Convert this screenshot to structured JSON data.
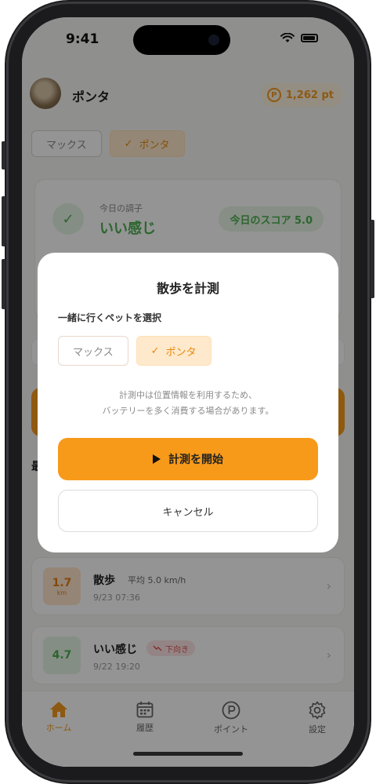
{
  "status_bar": {
    "time": "9:41"
  },
  "header": {
    "pet_name": "ポンタ",
    "points": "1,262 pt",
    "points_icon": "P"
  },
  "pet_chips": [
    {
      "label": "マックス",
      "selected": false
    },
    {
      "label": "ポンタ",
      "selected": true
    }
  ],
  "status_card": {
    "label": "今日の調子",
    "value": "いい感じ",
    "score": "今日のスコア 5.0"
  },
  "section_title": "最",
  "history": [
    {
      "badge_value": "1.7",
      "badge_unit": "km",
      "title": "散歩",
      "subtitle": "平均 5.0 km/h",
      "date": "9/23 07:36",
      "badge_color": "#ffe6cc"
    },
    {
      "badge_value": "4.7",
      "title": "いい感じ",
      "trend": "下向き",
      "date": "9/22 19:20",
      "badge_color": "#e5f4e4"
    }
  ],
  "tabs": [
    {
      "label": "ホーム",
      "icon": "home-icon",
      "active": true
    },
    {
      "label": "履歴",
      "icon": "calendar-icon",
      "active": false
    },
    {
      "label": "ポイント",
      "icon": "points-icon",
      "active": false
    },
    {
      "label": "設定",
      "icon": "gear-icon",
      "active": false
    }
  ],
  "modal": {
    "title": "散歩を計測",
    "select_label": "一緒に行くペットを選択",
    "pets": [
      {
        "label": "マックス",
        "selected": false
      },
      {
        "label": "ポンタ",
        "selected": true
      }
    ],
    "note_line1": "計測中は位置情報を利用するため、",
    "note_line2": "バッテリーを多く消費する場合があります。",
    "start_label": "計測を開始",
    "cancel_label": "キャンセル"
  },
  "colors": {
    "accent": "#f79a1a",
    "good": "#4caf50",
    "warn": "#e05555"
  }
}
